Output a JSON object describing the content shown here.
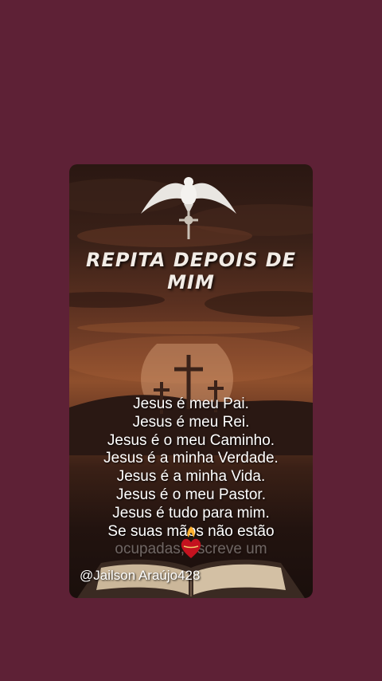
{
  "background_color": "#5e2136",
  "card": {
    "title": "REPITA DEPOIS DE MIM",
    "prayer_lines": [
      "Jesus é meu Pai.",
      "Jesus é meu Rei.",
      "Jesus é o meu Caminho.",
      "Jesus é a minha Verdade.",
      "Jesus é a minha Vida.",
      "Jesus é o meu Pastor.",
      "Jesus é tudo para mim.",
      "Se suas mãos não estão",
      "ocupadas, escreve um"
    ],
    "icons": [
      "dove-icon",
      "crucifix-icon",
      "three-crosses-icon",
      "sacred-heart-icon",
      "bible-icon"
    ]
  },
  "watermark": "@Jailson Araújo428"
}
